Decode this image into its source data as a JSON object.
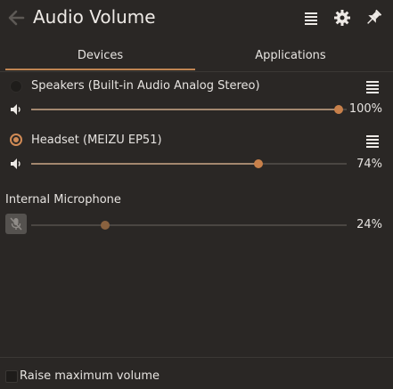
{
  "header": {
    "title": "Audio Volume",
    "icons": [
      "back-arrow-icon",
      "hamburger-icon",
      "gear-icon",
      "pin-icon"
    ]
  },
  "tabs": [
    {
      "label": "Devices",
      "active": true
    },
    {
      "label": "Applications",
      "active": false
    }
  ],
  "devices": [
    {
      "label": "Speakers (Built-in Audio Analog Stereo)",
      "selected": false,
      "volume_label": "100%",
      "volume": 1.0
    },
    {
      "label": "Headset (MEIZU EP51)",
      "selected": true,
      "volume_label": "74%",
      "volume": 0.74
    }
  ],
  "microphone": {
    "label": "Internal Microphone",
    "volume_label": "24%",
    "volume": 0.24,
    "muted": true
  },
  "footer": {
    "checkbox_label": "Raise maximum volume",
    "checked": false
  },
  "colors": {
    "background": "#2a2725",
    "accent": "#c8804a",
    "text": "#e6e3e0"
  }
}
